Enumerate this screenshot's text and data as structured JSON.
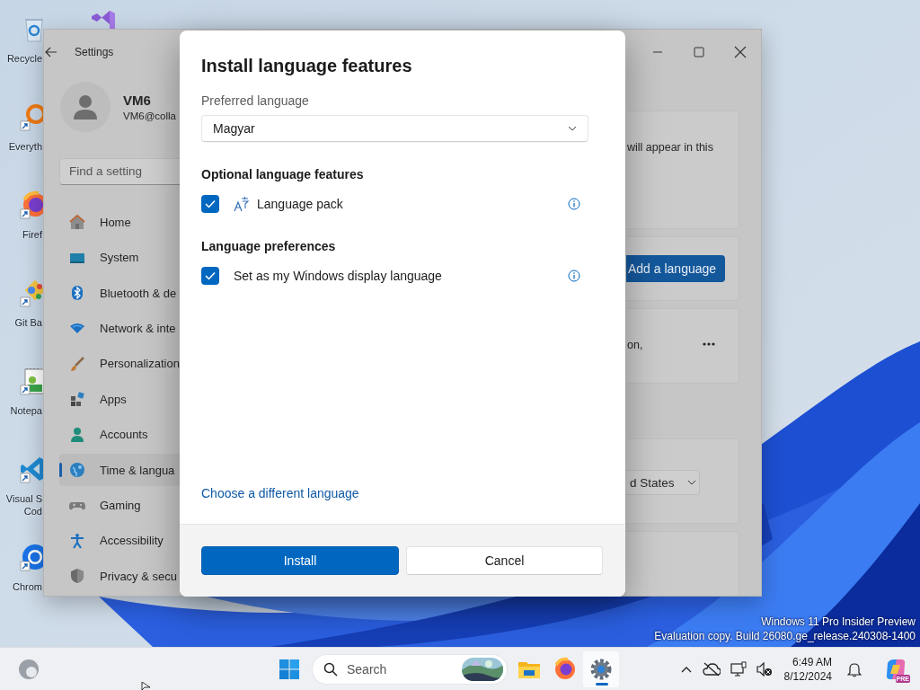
{
  "desktop": {
    "icons": [
      {
        "kind": "recycle",
        "label": "Recycle"
      },
      {
        "kind": "everything",
        "label": "Everyth"
      },
      {
        "kind": "firefox",
        "label": "Firef"
      },
      {
        "kind": "git",
        "label": "Git Ba"
      },
      {
        "kind": "notepad",
        "label": "Notepa"
      },
      {
        "kind": "vscode",
        "label": "Visual S\nCod"
      },
      {
        "kind": "chrome",
        "label": "Chrom"
      },
      {
        "kind": "visualstudio"
      }
    ],
    "watermark": [
      "Windows 11 Pro Insider Preview",
      "Evaluation copy. Build 26080.ge_release.240308-1400"
    ]
  },
  "settings_window": {
    "title": "Settings",
    "user": {
      "name": "VM6",
      "email": "VM6@colla"
    },
    "search": {
      "placeholder": "Find a setting"
    },
    "nav": [
      {
        "kind": "home",
        "label": "Home",
        "selected": false
      },
      {
        "kind": "system",
        "label": "System",
        "selected": false
      },
      {
        "kind": "bluetooth",
        "label": "Bluetooth & de",
        "selected": false
      },
      {
        "kind": "network",
        "label": "Network & inte",
        "selected": false
      },
      {
        "kind": "personalization",
        "label": "Personalization",
        "selected": false
      },
      {
        "kind": "apps",
        "label": "Apps",
        "selected": false
      },
      {
        "kind": "accounts",
        "label": "Accounts",
        "selected": false
      },
      {
        "kind": "time",
        "label": "Time & langua",
        "selected": true
      },
      {
        "kind": "gaming",
        "label": "Gaming",
        "selected": false
      },
      {
        "kind": "accessibility",
        "label": "Accessibility",
        "selected": false
      },
      {
        "kind": "privacy",
        "label": "Privacy & secu",
        "selected": false
      }
    ],
    "content": {
      "description": "will appear in this",
      "add_button": "Add a language",
      "entry_text": "on,",
      "region_value": "d States"
    }
  },
  "dialog": {
    "title": "Install language features",
    "preferred_label": "Preferred language",
    "preferred_value": "Magyar",
    "sections": [
      {
        "heading": "Optional language features",
        "options": [
          {
            "kind": "feature",
            "label": "Language pack",
            "checked": true
          }
        ]
      },
      {
        "heading": "Language preferences",
        "options": [
          {
            "kind": "preference",
            "label": "Set as my Windows display language",
            "checked": true
          }
        ]
      }
    ],
    "link": "Choose a different language",
    "buttons": [
      {
        "kind": "primary",
        "label": "Install"
      },
      {
        "kind": "secondary",
        "label": "Cancel"
      }
    ]
  },
  "taskbar": {
    "search_placeholder": "Search",
    "apps": [
      {
        "kind": "explorer",
        "active": false
      },
      {
        "kind": "firefox",
        "active": false
      },
      {
        "kind": "settings",
        "active": true
      }
    ],
    "time": "6:49 AM",
    "date": "8/12/2024",
    "copilot_badge": "PRE"
  }
}
